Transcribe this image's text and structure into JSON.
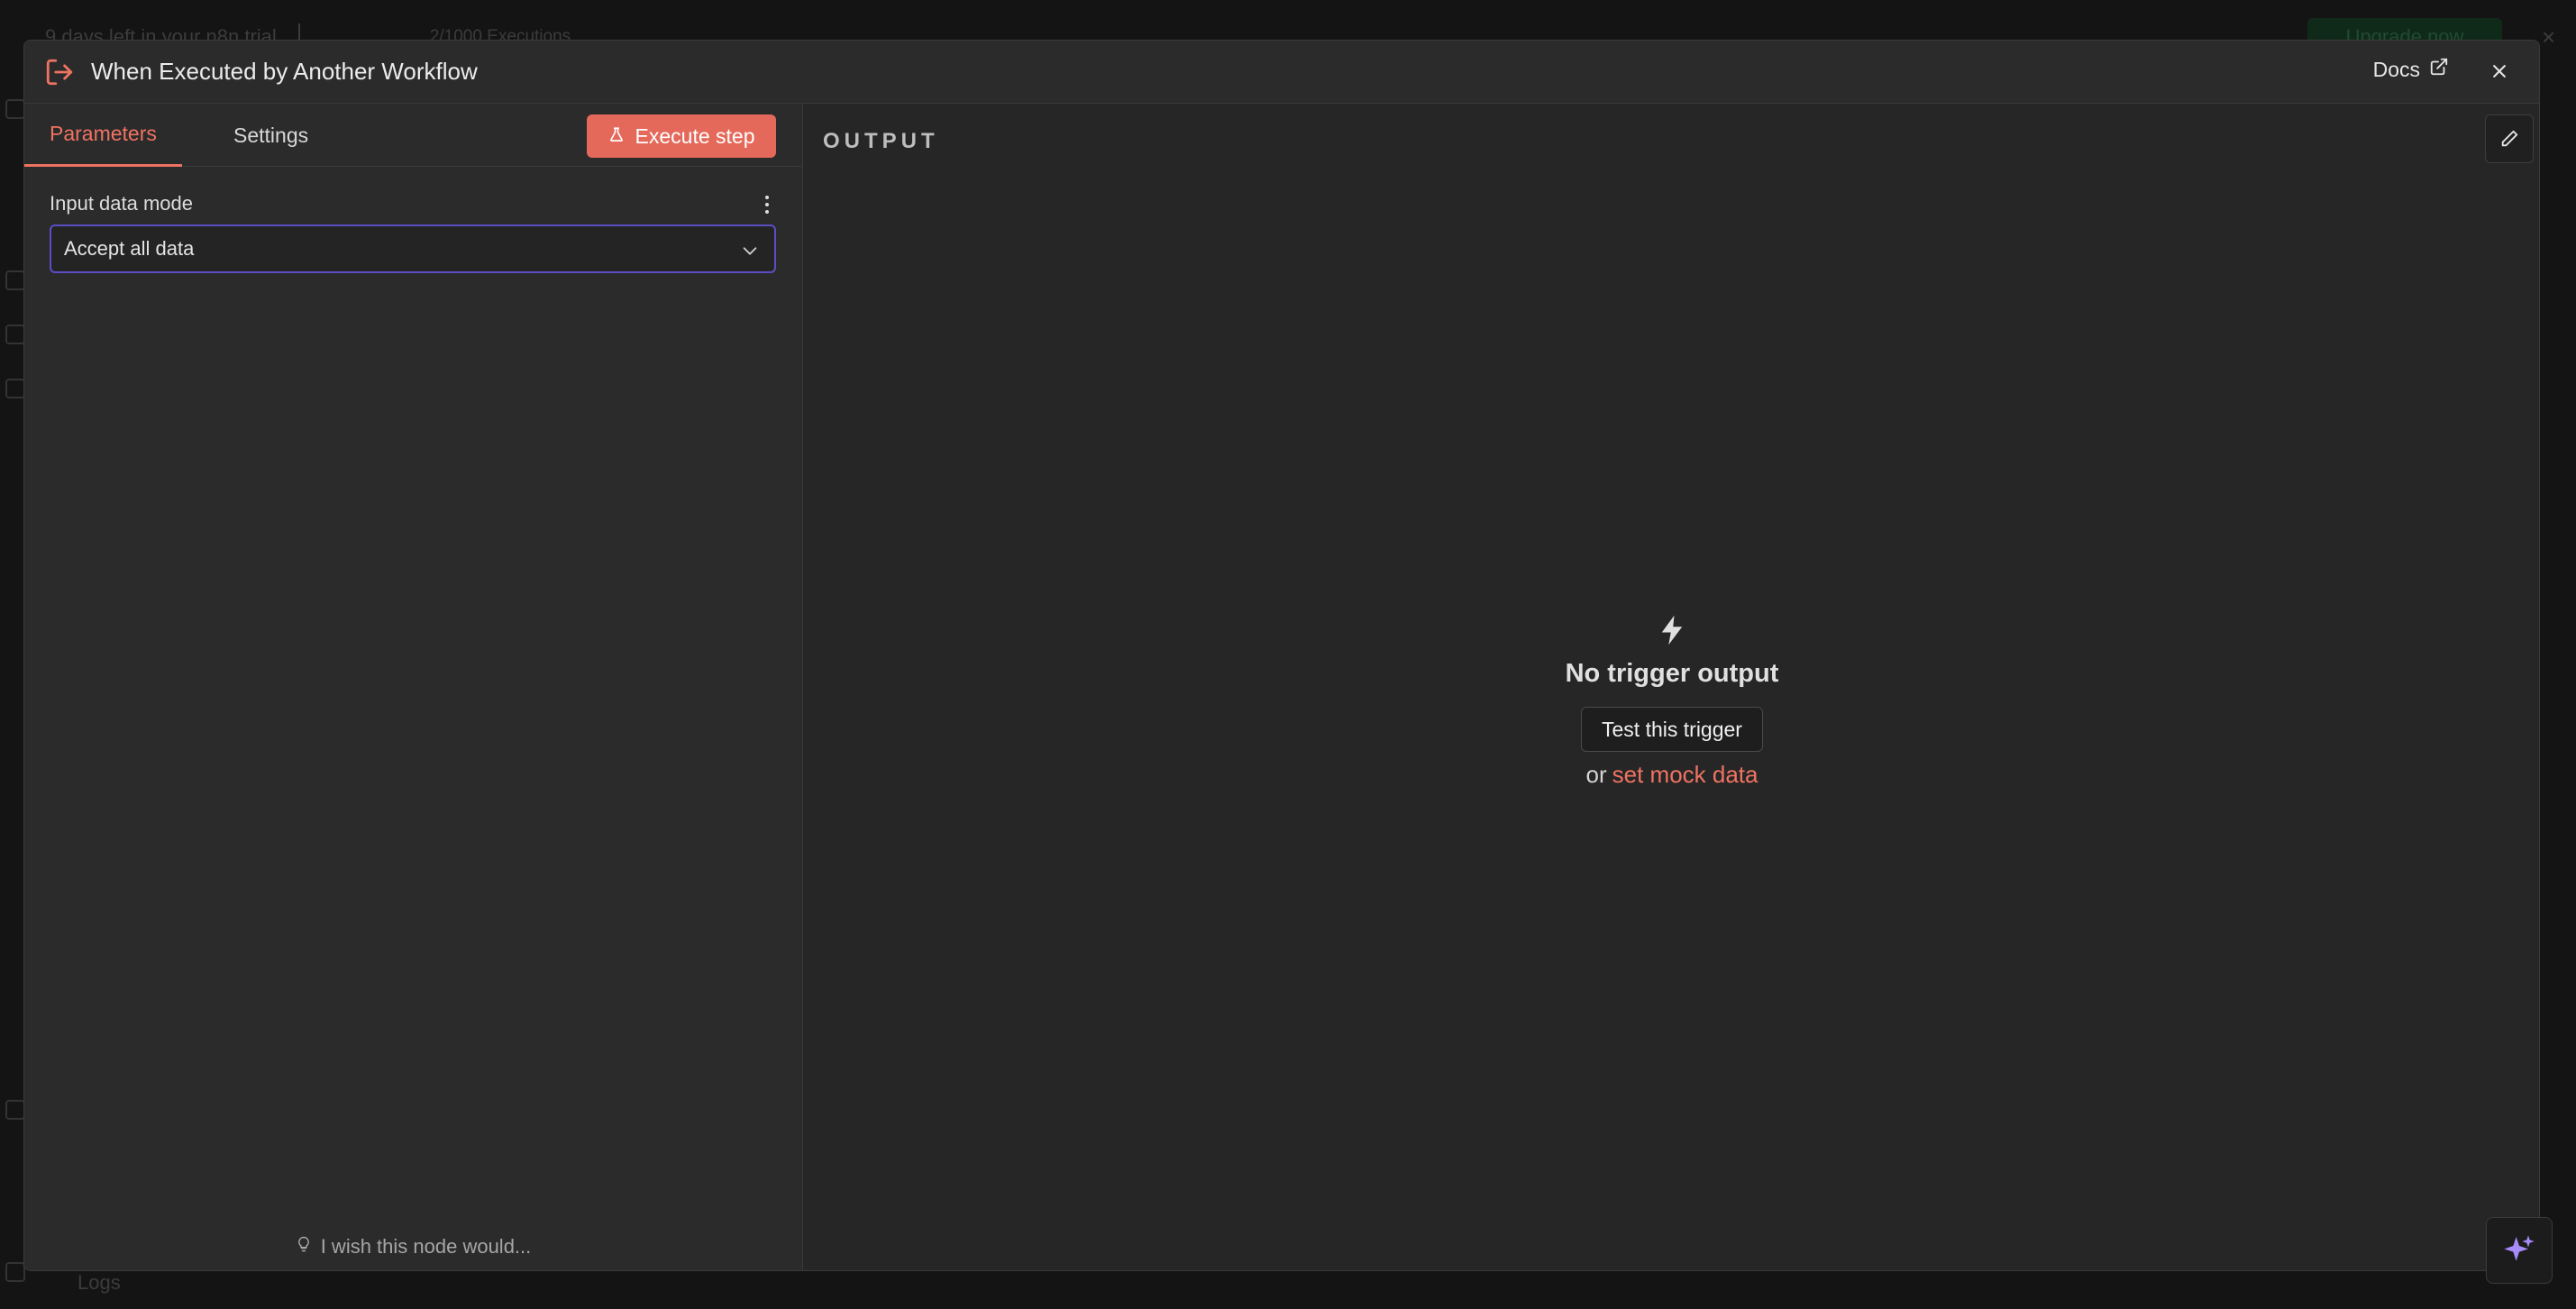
{
  "background": {
    "trial_text": "9 days left in your n8n trial",
    "executions_text": "2/1000 Executions",
    "upgrade_label": "Upgrade now",
    "logs_label": "Logs"
  },
  "modal": {
    "title": "When Executed by Another Workflow",
    "header_icon": "sign-out-icon",
    "docs_label": "Docs",
    "close_icon": "close-icon"
  },
  "parameters_panel": {
    "tabs": [
      {
        "label": "Parameters",
        "active": true
      },
      {
        "label": "Settings",
        "active": false
      }
    ],
    "execute_label": "Execute step",
    "field": {
      "label": "Input data mode",
      "value": "Accept all data"
    },
    "feedback_label": "I wish this node would..."
  },
  "output_panel": {
    "label": "OUTPUT",
    "empty_title": "No trigger output",
    "test_button_label": "Test this trigger",
    "or_text": "or",
    "mock_link_label": "set mock data"
  },
  "colors": {
    "accent": "#ef7363",
    "execute_bg": "#e5695a",
    "select_border": "#5b4ec4",
    "assistant": "#a78bfa"
  }
}
